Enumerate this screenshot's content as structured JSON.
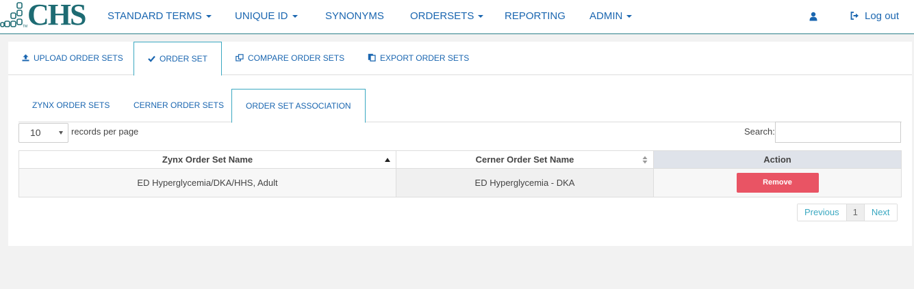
{
  "brand": {
    "name": "CHS",
    "tm": "TM"
  },
  "nav": {
    "items": [
      {
        "label": "STANDARD TERMS",
        "dropdown": true
      },
      {
        "label": "UNIQUE ID",
        "dropdown": true
      },
      {
        "label": "SYNONYMS",
        "dropdown": false
      },
      {
        "label": "ORDERSETS",
        "dropdown": true
      },
      {
        "label": "REPORTING",
        "dropdown": false
      },
      {
        "label": "ADMIN",
        "dropdown": true
      }
    ],
    "user_icon": "user-icon",
    "logout_label": "Log out"
  },
  "tabs": {
    "items": [
      {
        "label": "UPLOAD ORDER SETS",
        "icon": "upload-icon"
      },
      {
        "label": "ORDER SET",
        "icon": "check-icon",
        "active": true
      },
      {
        "label": "COMPARE ORDER SETS",
        "icon": "compare-icon"
      },
      {
        "label": "EXPORT ORDER SETS",
        "icon": "export-icon"
      }
    ]
  },
  "subtabs": {
    "items": [
      {
        "label": "ZYNX ORDER SETS"
      },
      {
        "label": "CERNER ORDER SETS"
      },
      {
        "label": "ORDER SET ASSOCIATION",
        "active": true
      }
    ]
  },
  "table_controls": {
    "page_length": "10",
    "page_length_label": "records per page",
    "search_label": "Search:",
    "search_value": ""
  },
  "table": {
    "columns": [
      "Zynx Order Set Name",
      "Cerner Order Set Name",
      "Action"
    ],
    "rows": [
      {
        "zynx": "ED Hyperglycemia/DKA/HHS, Adult",
        "cerner": "ED Hyperglycemia - DKA",
        "action": "Remove"
      }
    ]
  },
  "pagination": {
    "previous": "Previous",
    "current": "1",
    "next": "Next"
  },
  "colors": {
    "brand": "#1d6b73",
    "link": "#1a66b0",
    "accent": "#3aa8c1",
    "danger": "#e95464"
  }
}
